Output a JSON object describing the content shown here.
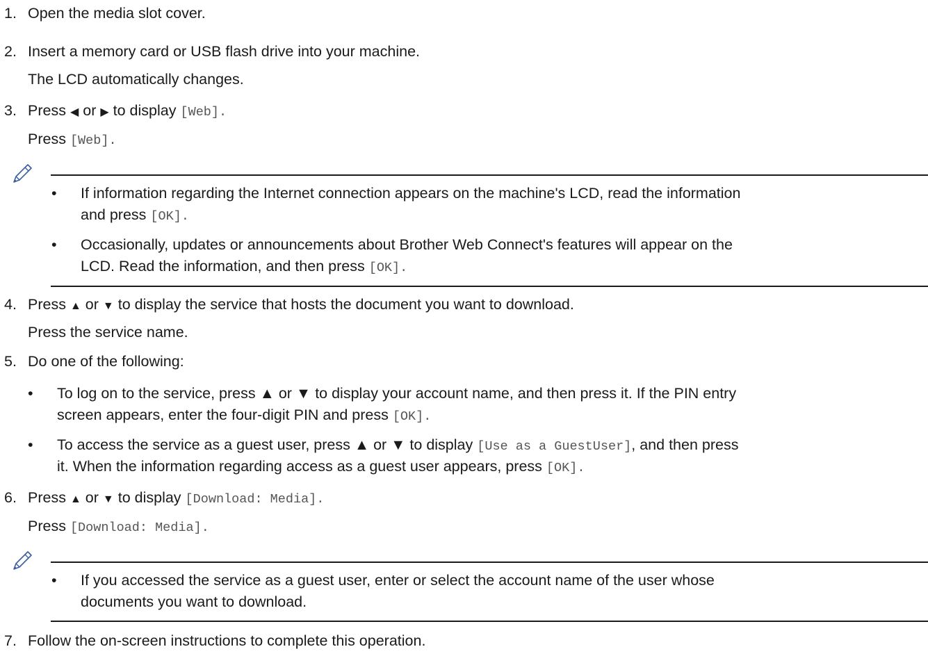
{
  "steps": [
    {
      "num": "1.",
      "text": "Open the media slot cover."
    },
    {
      "num": "2.",
      "text": "Insert a memory card or USB flash drive into your machine.",
      "sub": "The LCD automatically changes."
    },
    {
      "num": "3.",
      "pre": "Press",
      "arrow_left": "◀",
      "mid": "or",
      "arrow_right": "▶",
      "post": "to display",
      "code": "[Web]",
      "end": ".",
      "sub_pre": "Press",
      "sub_code": "[Web]",
      "sub_end": "."
    },
    {
      "num": "4.",
      "pre": "Press",
      "arrow_up": "▲",
      "mid": "or",
      "arrow_down": "▼",
      "post": "to display the service that hosts the document you want to download.",
      "sub": "Press the service name."
    },
    {
      "num": "5.",
      "text": "Do one of the following:"
    },
    {
      "num": "6.",
      "pre": "Press",
      "arrow_up": "▲",
      "mid": "or",
      "arrow_down": "▼",
      "post": "to display",
      "code": "[Download: Media]",
      "end": ".",
      "sub_pre": "Press",
      "sub_code": "[Download: Media]",
      "sub_end": "."
    },
    {
      "num": "7.",
      "text": "Follow the on-screen instructions to complete this operation."
    }
  ],
  "note1": {
    "b1_l1": "If information regarding the Internet connection appears on the machine's LCD, read the information",
    "b1_l2_pre": "and press",
    "b1_l2_code": "[OK]",
    "b1_l2_end": ".",
    "b2_l1": "Occasionally, updates or announcements about Brother Web Connect's features will appear on the",
    "b2_l2_pre": "LCD. Read the information, and then press",
    "b2_l2_code": "[OK]",
    "b2_l2_end": "."
  },
  "step5_bullets": {
    "b1_l1": "To log on to the service, press ▲ or ▼ to display your account name, and then press it. If the PIN entry",
    "b1_l2_pre": "screen appears, enter the four-digit PIN and press",
    "b1_l2_code": "[OK]",
    "b1_l2_end": ".",
    "b2_l1_pre": "To access the service as a guest user, press ▲ or ▼ to display",
    "b2_l1_code": "[Use as a GuestUser]",
    "b2_l1_post": ", and then press",
    "b2_l2_pre": "it. When the information regarding access as a guest user appears, press",
    "b2_l2_code": "[OK]",
    "b2_l2_end": "."
  },
  "note2": {
    "b1_l1": "If you accessed the service as a guest user, enter or select the account name of the user whose",
    "b1_l2": "documents you want to download."
  },
  "bullet_char": "•",
  "icons": {
    "note": "pencil-note-icon"
  }
}
